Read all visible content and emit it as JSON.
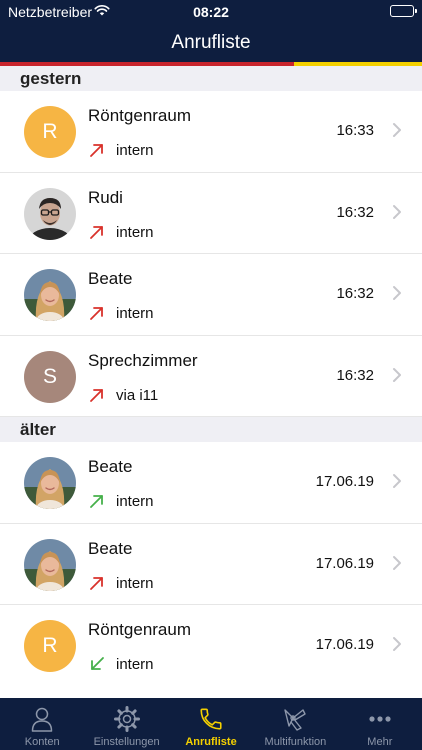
{
  "status_bar": {
    "carrier": "Netzbetreiber",
    "time": "08:22",
    "wifi_icon": "wifi-icon",
    "battery_level": 1.0
  },
  "nav_bar": {
    "title": "Anrufliste"
  },
  "accent_colors": {
    "red": "#c8242c",
    "yellow": "#f4d000",
    "navy": "#0e1e3f"
  },
  "sections": [
    {
      "title": "gestern",
      "calls": [
        {
          "name": "Röntgenraum",
          "avatar": "R",
          "avatar_type": "initial-orange",
          "direction": "outgoing",
          "via": "intern",
          "time": "16:33"
        },
        {
          "name": "Rudi",
          "avatar": "",
          "avatar_type": "photo-man",
          "direction": "outgoing",
          "via": "intern",
          "time": "16:32"
        },
        {
          "name": "Beate",
          "avatar": "",
          "avatar_type": "photo-woman",
          "direction": "outgoing",
          "via": "intern",
          "time": "16:32"
        },
        {
          "name": "Sprechzimmer",
          "avatar": "S",
          "avatar_type": "initial-taupe",
          "direction": "outgoing",
          "via": "via i11",
          "time": "16:32"
        }
      ]
    },
    {
      "title": "älter",
      "calls": [
        {
          "name": "Beate",
          "avatar": "",
          "avatar_type": "photo-woman",
          "direction": "outgoing-answered",
          "via": "intern",
          "time": "17.06.19"
        },
        {
          "name": "Beate",
          "avatar": "",
          "avatar_type": "photo-woman",
          "direction": "outgoing",
          "via": "intern",
          "time": "17.06.19"
        },
        {
          "name": "Röntgenraum",
          "avatar": "R",
          "avatar_type": "initial-orange",
          "direction": "incoming",
          "via": "intern",
          "time": "17.06.19"
        }
      ]
    }
  ],
  "tab_bar": {
    "items": [
      {
        "label": "Konten",
        "icon": "person-icon",
        "active": false
      },
      {
        "label": "Einstellungen",
        "icon": "gear-icon",
        "active": false
      },
      {
        "label": "Anrufliste",
        "icon": "phone-icon",
        "active": true
      },
      {
        "label": "Multifunktion",
        "icon": "multifunction-icon",
        "active": false
      },
      {
        "label": "Mehr",
        "icon": "more-icon",
        "active": false
      }
    ]
  }
}
